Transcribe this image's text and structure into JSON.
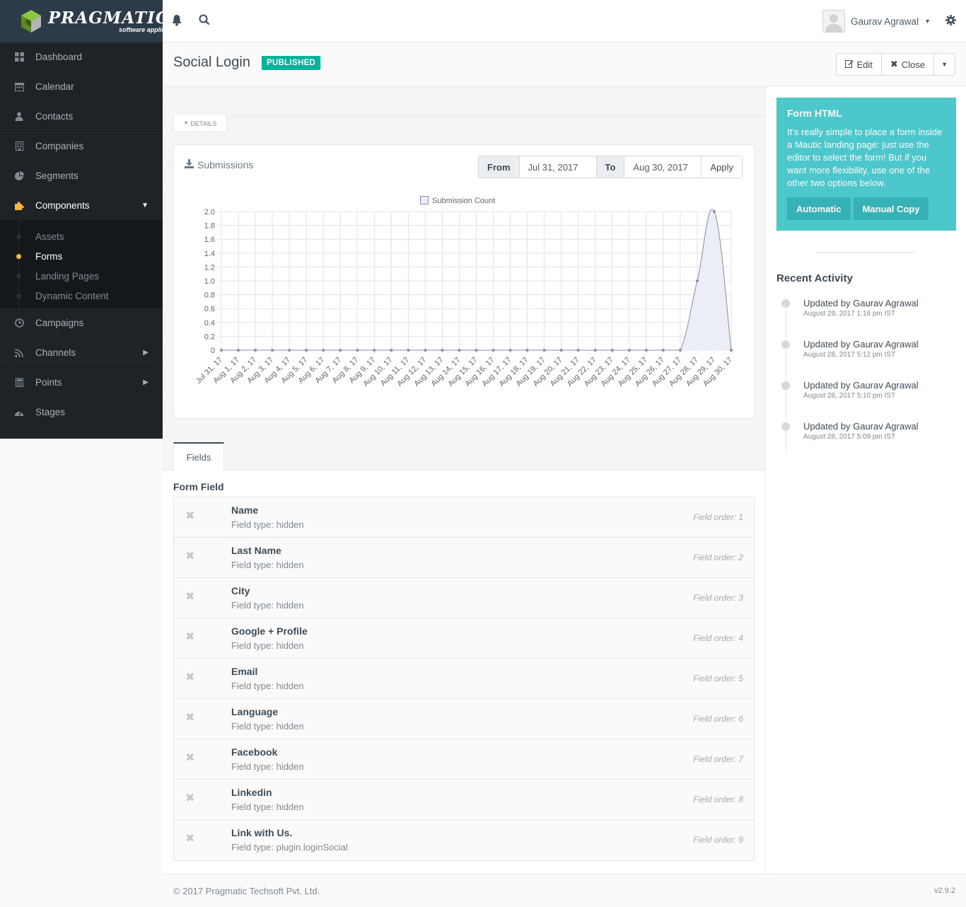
{
  "brand": {
    "name": "PRAGMATIC",
    "tagline": "software applied"
  },
  "sidebar": {
    "items": [
      {
        "label": "Dashboard",
        "icon": "grid-icon"
      },
      {
        "label": "Calendar",
        "icon": "calendar-icon"
      },
      {
        "label": "Contacts",
        "icon": "user-icon"
      },
      {
        "label": "Companies",
        "icon": "building-icon"
      },
      {
        "label": "Segments",
        "icon": "pie-chart-icon"
      },
      {
        "label": "Components",
        "icon": "puzzle-icon"
      },
      {
        "label": "Campaigns",
        "icon": "clock-icon"
      },
      {
        "label": "Channels",
        "icon": "rss-icon"
      },
      {
        "label": "Points",
        "icon": "calculator-icon"
      },
      {
        "label": "Stages",
        "icon": "tachometer-icon"
      }
    ],
    "sub_items": [
      "Assets",
      "Forms",
      "Landing Pages",
      "Dynamic Content"
    ],
    "active_item": "Components",
    "active_sub_item": "Forms"
  },
  "topbar": {
    "user_name": "Gaurav Agrawal"
  },
  "header": {
    "title": "Social Login",
    "status": "PUBLISHED",
    "edit_label": "Edit",
    "close_label": "Close"
  },
  "details_tab": "DETAILS",
  "submissions": {
    "title": "Submissions",
    "from_label": "From",
    "from_value": "Jul 31, 2017",
    "to_label": "To",
    "to_value": "Aug 30, 2017",
    "apply_label": "Apply"
  },
  "chart_data": {
    "type": "line",
    "legend": [
      "Submission Count"
    ],
    "legend_position": "top-center",
    "grid": true,
    "ylim": [
      0,
      2.0
    ],
    "y_ticks": [
      "0",
      "0.2",
      "0.4",
      "0.6",
      "0.8",
      "1.0",
      "1.2",
      "1.4",
      "1.6",
      "1.8",
      "2.0"
    ],
    "categories": [
      "Jul 31, 17",
      "Aug 1, 17",
      "Aug 2, 17",
      "Aug 3, 17",
      "Aug 4, 17",
      "Aug 5, 17",
      "Aug 6, 17",
      "Aug 7, 17",
      "Aug 8, 17",
      "Aug 9, 17",
      "Aug 10, 17",
      "Aug 11, 17",
      "Aug 12, 17",
      "Aug 13, 17",
      "Aug 14, 17",
      "Aug 15, 17",
      "Aug 16, 17",
      "Aug 17, 17",
      "Aug 18, 17",
      "Aug 19, 17",
      "Aug 20, 17",
      "Aug 21, 17",
      "Aug 22, 17",
      "Aug 23, 17",
      "Aug 24, 17",
      "Aug 25, 17",
      "Aug 26, 17",
      "Aug 27, 17",
      "Aug 28, 17",
      "Aug 29, 17",
      "Aug 30, 17"
    ],
    "series": [
      {
        "name": "Submission Count",
        "values": [
          0,
          0,
          0,
          0,
          0,
          0,
          0,
          0,
          0,
          0,
          0,
          0,
          0,
          0,
          0,
          0,
          0,
          0,
          0,
          0,
          0,
          0,
          0,
          0,
          0,
          0,
          0,
          0,
          1,
          2,
          0
        ]
      }
    ],
    "colors": {
      "line": "#8688b6",
      "fill": "#eceef5",
      "grid": "#e3e3e3"
    }
  },
  "fields_tab": "Fields",
  "form_field_heading": "Form Field",
  "fields": [
    {
      "name": "Name",
      "type": "Field type: hidden",
      "order": "Field order: 1"
    },
    {
      "name": "Last Name",
      "type": "Field type: hidden",
      "order": "Field order: 2"
    },
    {
      "name": "City",
      "type": "Field type: hidden",
      "order": "Field order: 3"
    },
    {
      "name": "Google + Profile",
      "type": "Field type: hidden",
      "order": "Field order: 4"
    },
    {
      "name": "Email",
      "type": "Field type: hidden",
      "order": "Field order: 5"
    },
    {
      "name": "Language",
      "type": "Field type: hidden",
      "order": "Field order: 6"
    },
    {
      "name": "Facebook",
      "type": "Field type: hidden",
      "order": "Field order: 7"
    },
    {
      "name": "Linkedin",
      "type": "Field type: hidden",
      "order": "Field order: 8"
    },
    {
      "name": "Link with Us.",
      "type": "Field type: plugin.loginSocial",
      "order": "Field order: 9"
    }
  ],
  "form_html": {
    "title": "Form HTML",
    "text": "It's really simple to place a form inside a Mautic landing page: just use the editor to select the form! But if you want more flexibility, use one of the other two options below.",
    "automatic_label": "Automatic",
    "manual_label": "Manual Copy"
  },
  "recent_activity": {
    "title": "Recent Activity",
    "items": [
      {
        "who": "Updated by Gaurav Agrawal",
        "when": "August 29, 2017 1:16 pm IST"
      },
      {
        "who": "Updated by Gaurav Agrawal",
        "when": "August 28, 2017 5:12 pm IST"
      },
      {
        "who": "Updated by Gaurav Agrawal",
        "when": "August 28, 2017 5:10 pm IST"
      },
      {
        "who": "Updated by Gaurav Agrawal",
        "when": "August 28, 2017 5:09 pm IST"
      }
    ]
  },
  "footer": {
    "copyright": "© 2017 Pragmatic Techsoft Pvt. Ltd.",
    "version": "v2.9.2"
  }
}
